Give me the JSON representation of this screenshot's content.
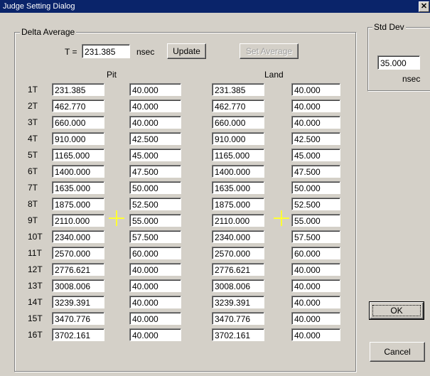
{
  "window": {
    "title": "Judge Setting Dialog",
    "close_glyph": "✕"
  },
  "delta_average": {
    "group_label": "Delta Average",
    "t_label": "T =",
    "t_value": "231.385",
    "t_unit": "nsec",
    "update_label": "Update",
    "set_average_label": "Set Average"
  },
  "columns": {
    "pit_header": "Pit",
    "land_header": "Land"
  },
  "rows": [
    {
      "label": "1T",
      "pit_time": "231.385",
      "pit_dev": "40.000",
      "land_time": "231.385",
      "land_dev": "40.000"
    },
    {
      "label": "2T",
      "pit_time": "462.770",
      "pit_dev": "40.000",
      "land_time": "462.770",
      "land_dev": "40.000"
    },
    {
      "label": "3T",
      "pit_time": "660.000",
      "pit_dev": "40.000",
      "land_time": "660.000",
      "land_dev": "40.000"
    },
    {
      "label": "4T",
      "pit_time": "910.000",
      "pit_dev": "42.500",
      "land_time": "910.000",
      "land_dev": "42.500"
    },
    {
      "label": "5T",
      "pit_time": "1165.000",
      "pit_dev": "45.000",
      "land_time": "1165.000",
      "land_dev": "45.000"
    },
    {
      "label": "6T",
      "pit_time": "1400.000",
      "pit_dev": "47.500",
      "land_time": "1400.000",
      "land_dev": "47.500"
    },
    {
      "label": "7T",
      "pit_time": "1635.000",
      "pit_dev": "50.000",
      "land_time": "1635.000",
      "land_dev": "50.000"
    },
    {
      "label": "8T",
      "pit_time": "1875.000",
      "pit_dev": "52.500",
      "land_time": "1875.000",
      "land_dev": "52.500"
    },
    {
      "label": "9T",
      "pit_time": "2110.000",
      "pit_dev": "55.000",
      "land_time": "2110.000",
      "land_dev": "55.000"
    },
    {
      "label": "10T",
      "pit_time": "2340.000",
      "pit_dev": "57.500",
      "land_time": "2340.000",
      "land_dev": "57.500"
    },
    {
      "label": "11T",
      "pit_time": "2570.000",
      "pit_dev": "60.000",
      "land_time": "2570.000",
      "land_dev": "60.000"
    },
    {
      "label": "12T",
      "pit_time": "2776.621",
      "pit_dev": "40.000",
      "land_time": "2776.621",
      "land_dev": "40.000"
    },
    {
      "label": "13T",
      "pit_time": "3008.006",
      "pit_dev": "40.000",
      "land_time": "3008.006",
      "land_dev": "40.000"
    },
    {
      "label": "14T",
      "pit_time": "3239.391",
      "pit_dev": "40.000",
      "land_time": "3239.391",
      "land_dev": "40.000"
    },
    {
      "label": "15T",
      "pit_time": "3470.776",
      "pit_dev": "40.000",
      "land_time": "3470.776",
      "land_dev": "40.000"
    },
    {
      "label": "16T",
      "pit_time": "3702.161",
      "pit_dev": "40.000",
      "land_time": "3702.161",
      "land_dev": "40.000"
    }
  ],
  "std_dev": {
    "group_label": "Std Dev",
    "value": "35.000",
    "unit": "nsec"
  },
  "buttons": {
    "ok_label": "OK",
    "cancel_label": "Cancel"
  },
  "icons": {
    "pit_plus": "plus-icon",
    "land_plus": "plus-icon",
    "plus_color": "#ffff33"
  }
}
